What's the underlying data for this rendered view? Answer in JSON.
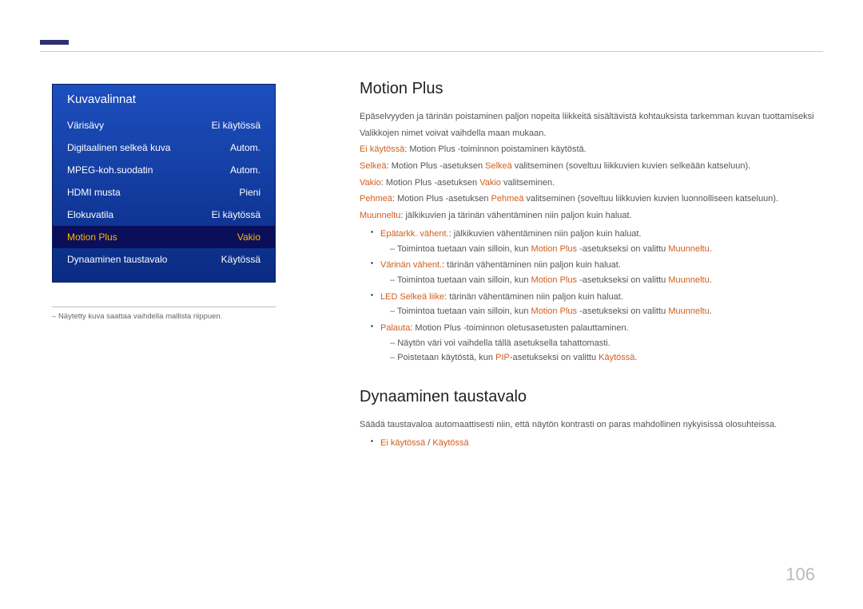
{
  "menu": {
    "title": "Kuvavalinnat",
    "items": [
      {
        "label": "Värisävy",
        "value": "Ei käytössä",
        "selected": false
      },
      {
        "label": "Digitaalinen selkeä kuva",
        "value": "Autom.",
        "selected": false
      },
      {
        "label": "MPEG-koh.suodatin",
        "value": "Autom.",
        "selected": false
      },
      {
        "label": "HDMI musta",
        "value": "Pieni",
        "selected": false
      },
      {
        "label": "Elokuvatila",
        "value": "Ei käytössä",
        "selected": false
      },
      {
        "label": "Motion Plus",
        "value": "Vakio",
        "selected": true
      },
      {
        "label": "Dynaaminen taustavalo",
        "value": "Käytössä",
        "selected": false
      }
    ],
    "footnote": "Näytetty kuva saattaa vaihdella mallista riippuen."
  },
  "mp": {
    "title": "Motion Plus",
    "intro1": "Epäselvyyden ja tärinän poistaminen paljon nopeita liikkeitä sisältävistä kohtauksista tarkemman kuvan tuottamiseksi",
    "intro2": "Valikkojen nimet voivat vaihdella maan mukaan.",
    "off_lbl": "Ei käytössä",
    "off_txt": ": Motion Plus -toiminnon poistaminen käytöstä.",
    "clear_lbl": "Selkeä",
    "clear_pre": ": Motion Plus -asetuksen ",
    "clear_opt": "Selkeä",
    "clear_txt": " valitseminen (soveltuu liikkuvien kuvien selkeään katseluun).",
    "std_lbl": "Vakio",
    "std_pre": ": Motion Plus -asetuksen ",
    "std_opt": "Vakio",
    "std_txt": " valitseminen.",
    "smooth_lbl": "Pehmeä",
    "smooth_pre": ": Motion Plus -asetuksen ",
    "smooth_opt": "Pehmeä",
    "smooth_txt": " valitseminen (soveltuu liikkuvien kuvien luonnolliseen katseluun).",
    "cust_lbl": "Muunneltu",
    "cust_txt": ": jälkikuvien ja tärinän vähentäminen niin paljon kuin haluat.",
    "b1_lbl": "Epätarkk. vähent.",
    "b1_txt": ": jälkikuvien vähentäminen niin paljon kuin haluat.",
    "b2_lbl": "Värinän vähent.",
    "b2_txt": ": tärinän vähentäminen niin paljon kuin haluat.",
    "b3_lbl": "LED Selkeä liike",
    "b3_txt": ": tärinän vähentäminen niin paljon kuin haluat.",
    "b4_lbl": "Palauta",
    "b4_txt": ": Motion Plus -toiminnon oletusasetusten palauttaminen.",
    "sub_a": "Toimintoa tuetaan vain silloin, kun ",
    "sub_b": "Motion Plus",
    "sub_c": " -asetukseksi on valittu ",
    "sub_d": "Muunneltu",
    "sub_e": ".",
    "b4s1": "Näytön väri voi vaihdella tällä asetuksella tahattomasti.",
    "b4s2a": "Poistetaan käytöstä, kun ",
    "b4s2b": "PIP",
    "b4s2c": "-asetukseksi on valittu ",
    "b4s2d": "Käytössä",
    "b4s2e": "."
  },
  "dbl": {
    "title": "Dynaaminen taustavalo",
    "body": "Säädä taustavaloa automaattisesti niin, että näytön kontrasti on paras mahdollinen nykyisissä olosuhteissa.",
    "opt1": "Ei käytössä",
    "sep": " / ",
    "opt2": "Käytössä"
  },
  "page": "106"
}
